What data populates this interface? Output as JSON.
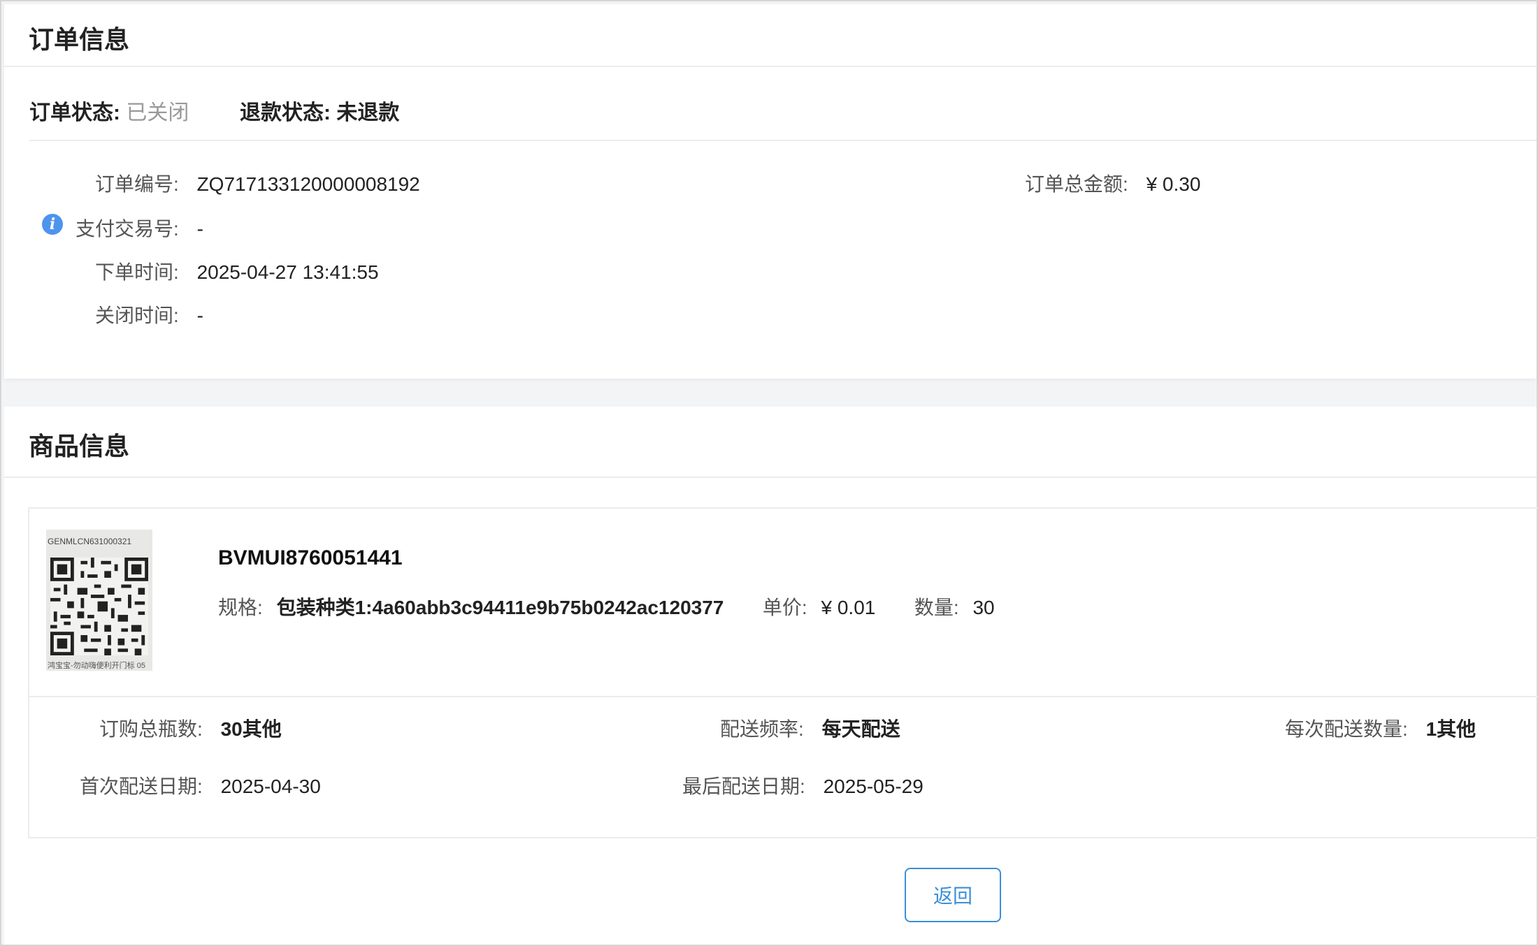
{
  "order_section": {
    "title": "订单信息",
    "order_status_label": "订单状态:",
    "order_status_value": "已关闭",
    "refund_status_label": "退款状态:",
    "refund_status_value": "未退款",
    "order_no_label": "订单编号:",
    "order_no_value": "ZQ717133120000008192",
    "total_amount_label": "订单总金额:",
    "total_amount_value": "¥ 0.30",
    "pay_txn_label": "支付交易号:",
    "pay_txn_value": "-",
    "order_time_label": "下单时间:",
    "order_time_value": "2025-04-27 13:41:55",
    "close_time_label": "关闭时间:",
    "close_time_value": "-",
    "info_icon": "i"
  },
  "goods_section": {
    "title": "商品信息",
    "image_top_text": "GENMLCN631000321",
    "image_bottom_text": "鸿宝宝-勿动嗨便利开门标 05",
    "goods_name": "BVMUI8760051441",
    "spec_label": "规格:",
    "spec_value": "包装种类1:4a60abb3c94411e9b75b0242ac120377",
    "unit_price_label": "单价:",
    "unit_price_value": "¥ 0.01",
    "quantity_label": "数量:",
    "quantity_value": "30",
    "total_bottles_label": "订购总瓶数:",
    "total_bottles_value": "30其他",
    "delivery_freq_label": "配送频率:",
    "delivery_freq_value": "每天配送",
    "per_delivery_label": "每次配送数量:",
    "per_delivery_value": "1其他",
    "first_date_label": "首次配送日期:",
    "first_date_value": "2025-04-30",
    "last_date_label": "最后配送日期:",
    "last_date_value": "2025-05-29"
  },
  "actions": {
    "back_label": "返回"
  },
  "colors": {
    "accent": "#3b8fd8",
    "info_icon": "#4d94ef",
    "muted": "#999999"
  }
}
